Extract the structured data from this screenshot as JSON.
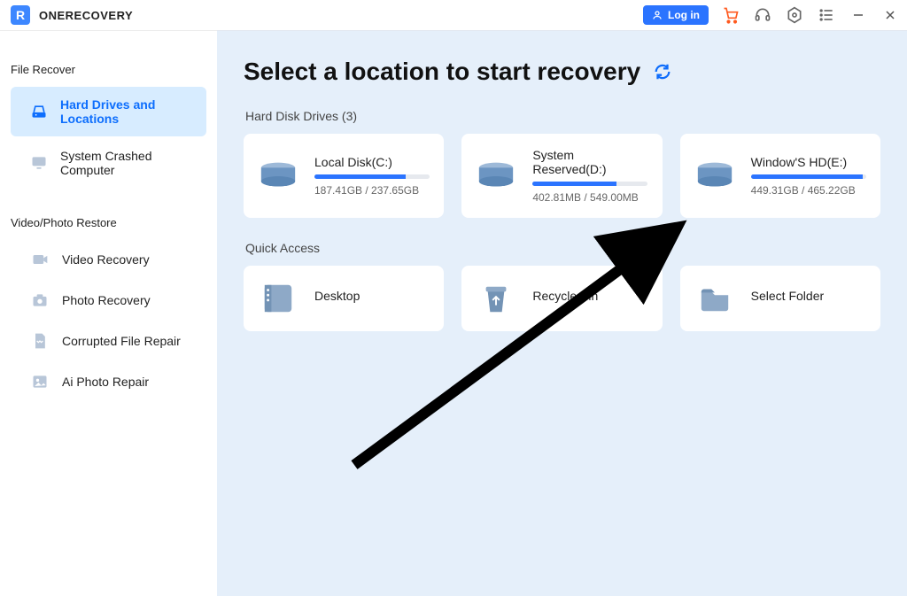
{
  "brand": {
    "name": "ONERECOVERY",
    "logo_text": "R"
  },
  "titlebar": {
    "login_label": "Log in"
  },
  "sidebar": {
    "section1_title": "File Recover",
    "section2_title": "Video/Photo Restore",
    "items": {
      "hdd": "Hard Drives and Locations",
      "crashed": "System Crashed Computer",
      "video": "Video Recovery",
      "photo": "Photo Recovery",
      "corrupt": "Corrupted File Repair",
      "aiphoto": "Ai Photo Repair"
    }
  },
  "main": {
    "title": "Select a location to start recovery",
    "section_drives": "Hard Disk Drives (3)",
    "section_quick": "Quick Access",
    "drives": [
      {
        "name": "Local Disk(C:)",
        "usage": "187.41GB / 237.65GB",
        "percent": 79
      },
      {
        "name": "System Reserved(D:)",
        "usage": "402.81MB / 549.00MB",
        "percent": 73
      },
      {
        "name": "Window'S HD(E:)",
        "usage": "449.31GB / 465.22GB",
        "percent": 97
      }
    ],
    "quick": [
      {
        "name": "Desktop"
      },
      {
        "name": "Recycle Bin"
      },
      {
        "name": "Select Folder"
      }
    ]
  }
}
